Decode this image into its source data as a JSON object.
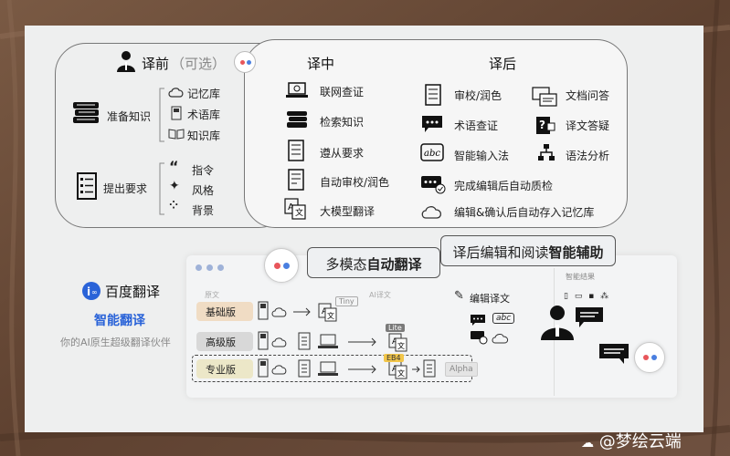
{
  "before": {
    "title": "译前",
    "optional": "（可选）",
    "prep_knowledge": "准备知识",
    "memory": "记忆库",
    "terms": "术语库",
    "knowledge": "知识库",
    "requirements": "提出要求",
    "instruction": "指令",
    "style": "风格",
    "background": "背景"
  },
  "during": {
    "title": "译中",
    "items": [
      "联网查证",
      "检索知识",
      "遵从要求",
      "自动审校/润色",
      "大模型翻译"
    ]
  },
  "after": {
    "title": "译后",
    "left_items": [
      "审校/润色",
      "术语查证",
      "智能输入法",
      "完成编辑后自动质检",
      "编辑&确认后自动存入记忆库"
    ],
    "right_items": [
      "文档问答",
      "译文答疑",
      "语法分析"
    ]
  },
  "brand": {
    "name": "百度翻译",
    "product": "智能翻译",
    "slogan": "你的AI原生超级翻译伙伴"
  },
  "callouts": {
    "auto_prefix": "多模态",
    "auto_strong": "自动翻译",
    "assist_prefix": "译后编辑和阅读",
    "assist_strong": "智能辅助"
  },
  "tiers": {
    "basic": "基础版",
    "advanced": "高级版",
    "pro": "专业版",
    "tiny": "Tiny",
    "lite": "Lite",
    "badge_pro": "EB4",
    "alpha": "Alpha"
  },
  "screenshot": {
    "original": "原文",
    "ai_translation": "AI译文",
    "edit_translation": "编辑译文",
    "abc": "abc",
    "panel_title": "智能结果"
  },
  "watermark": "@梦绘云端",
  "colors": {
    "basic_bar": "#f0dcc4",
    "advanced_bar": "#d8d8d8",
    "pro_bar": "#ece7c8",
    "pro_dash": "#444444",
    "brand_blue": "#2a63d8",
    "dot_red": "#e8565b",
    "dot_blue": "#4a7fe0"
  }
}
